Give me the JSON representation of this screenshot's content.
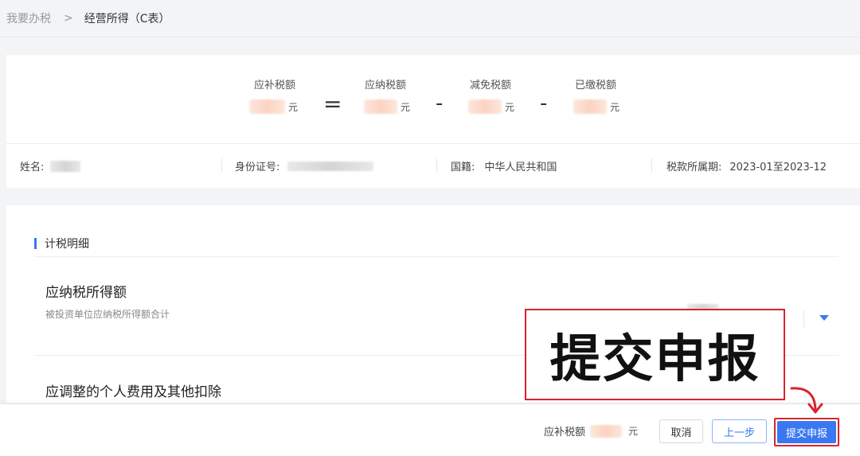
{
  "breadcrumb": {
    "home": "我要办税",
    "separator": ">",
    "current": "经营所得（C表）"
  },
  "formula": {
    "terms": [
      {
        "label": "应补税额",
        "unit": "元"
      },
      {
        "label": "应纳税额",
        "unit": "元"
      },
      {
        "label": "减免税额",
        "unit": "元"
      },
      {
        "label": "已缴税额",
        "unit": "元"
      }
    ],
    "equals": "=",
    "minus": "-"
  },
  "info": {
    "name_label": "姓名:",
    "id_label": "身份证号:",
    "nationality_label": "国籍:",
    "nationality_value": "中华人民共和国",
    "period_label": "税款所属期:",
    "period_value": "2023-01至2023-12"
  },
  "details": {
    "section_title": "计税明细",
    "items": [
      {
        "title": "应纳税所得额",
        "desc": "被投资单位应纳税所得额合计"
      },
      {
        "title": "应调整的个人费用及其他扣除"
      }
    ]
  },
  "annotation": {
    "text": "提交申报",
    "border_color": "#d8242e"
  },
  "footer": {
    "tax_due_label": "应补税额",
    "unit": "元",
    "cancel_label": "取消",
    "prev_label": "上一步",
    "submit_label": "提交申报"
  },
  "colors": {
    "accent": "#3a78f2",
    "highlight": "#d8242e"
  },
  "icons": {
    "expand": "caret-down-icon",
    "annotation_pointer": "curved-arrow-icon"
  }
}
